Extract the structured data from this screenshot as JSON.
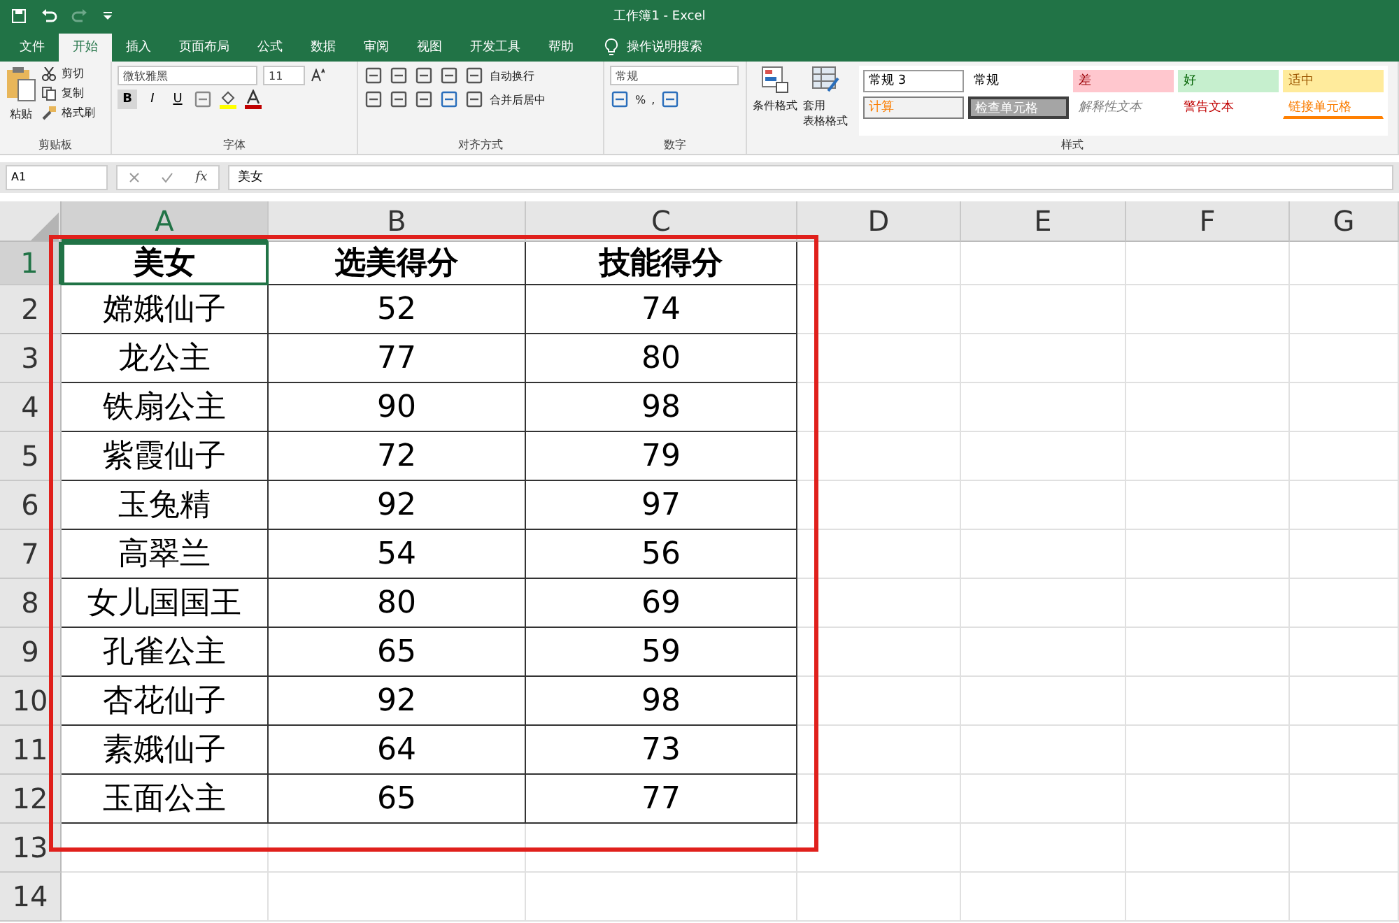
{
  "window": {
    "title": "工作簿1  -  Excel"
  },
  "menu_tabs": [
    {
      "label": "文件",
      "selected": false
    },
    {
      "label": "开始",
      "selected": true
    },
    {
      "label": "插入",
      "selected": false
    },
    {
      "label": "页面布局",
      "selected": false
    },
    {
      "label": "公式",
      "selected": false
    },
    {
      "label": "数据",
      "selected": false
    },
    {
      "label": "审阅",
      "selected": false
    },
    {
      "label": "视图",
      "selected": false
    },
    {
      "label": "开发工具",
      "selected": false
    },
    {
      "label": "帮助",
      "selected": false
    }
  ],
  "tell_me": "操作说明搜索",
  "clipboard": {
    "paste": "粘贴",
    "cut": "剪切",
    "copy": "复制",
    "format_painter": "格式刷",
    "group": "剪贴板"
  },
  "font": {
    "name": "微软雅黑",
    "size": "11",
    "bold": "B",
    "italic": "I",
    "underline": "U",
    "group": "字体"
  },
  "alignment": {
    "wrap": "自动换行",
    "merge": "合并后居中",
    "group": "对齐方式"
  },
  "number": {
    "format": "常规",
    "percent": "%",
    "comma": ",",
    "group": "数字"
  },
  "styles": {
    "conditional": "条件格式",
    "table_format_1": "套用",
    "table_format_2": "表格格式",
    "group": "样式",
    "cells": [
      {
        "label": "常规 3",
        "kind": "normal3"
      },
      {
        "label": "常规",
        "kind": "normal"
      },
      {
        "label": "差",
        "kind": "bad"
      },
      {
        "label": "好",
        "kind": "good"
      },
      {
        "label": "适中",
        "kind": "neutral"
      },
      {
        "label": "计算",
        "kind": "calc"
      },
      {
        "label": "检查单元格",
        "kind": "check"
      },
      {
        "label": "解释性文本",
        "kind": "explain"
      },
      {
        "label": "警告文本",
        "kind": "warning"
      },
      {
        "label": "链接单元格",
        "kind": "linked"
      }
    ]
  },
  "formula_bar": {
    "name_box": "A1",
    "fx": "fx",
    "value": "美女"
  },
  "columns": [
    {
      "label": "A",
      "selected": true
    },
    {
      "label": "B",
      "selected": false
    },
    {
      "label": "C",
      "selected": false
    },
    {
      "label": "D",
      "selected": false
    },
    {
      "label": "E",
      "selected": false
    },
    {
      "label": "F",
      "selected": false
    },
    {
      "label": "G",
      "selected": false
    }
  ],
  "rows": [
    {
      "number": "1",
      "selected": true,
      "cells": [
        "美女",
        "选美得分",
        "技能得分"
      ]
    },
    {
      "number": "2",
      "selected": false,
      "cells": [
        "嫦娥仙子",
        "52",
        "74"
      ]
    },
    {
      "number": "3",
      "selected": false,
      "cells": [
        "龙公主",
        "77",
        "80"
      ]
    },
    {
      "number": "4",
      "selected": false,
      "cells": [
        "铁扇公主",
        "90",
        "98"
      ]
    },
    {
      "number": "5",
      "selected": false,
      "cells": [
        "紫霞仙子",
        "72",
        "79"
      ]
    },
    {
      "number": "6",
      "selected": false,
      "cells": [
        "玉兔精",
        "92",
        "97"
      ]
    },
    {
      "number": "7",
      "selected": false,
      "cells": [
        "高翠兰",
        "54",
        "56"
      ]
    },
    {
      "number": "8",
      "selected": false,
      "cells": [
        "女儿国国王",
        "80",
        "69"
      ]
    },
    {
      "number": "9",
      "selected": false,
      "cells": [
        "孔雀公主",
        "65",
        "59"
      ]
    },
    {
      "number": "10",
      "selected": false,
      "cells": [
        "杏花仙子",
        "92",
        "98"
      ]
    },
    {
      "number": "11",
      "selected": false,
      "cells": [
        "素娥仙子",
        "64",
        "73"
      ]
    },
    {
      "number": "12",
      "selected": false,
      "cells": [
        "玉面公主",
        "65",
        "77"
      ]
    },
    {
      "number": "13",
      "selected": false,
      "cells": []
    },
    {
      "number": "14",
      "selected": false,
      "cells": []
    }
  ]
}
